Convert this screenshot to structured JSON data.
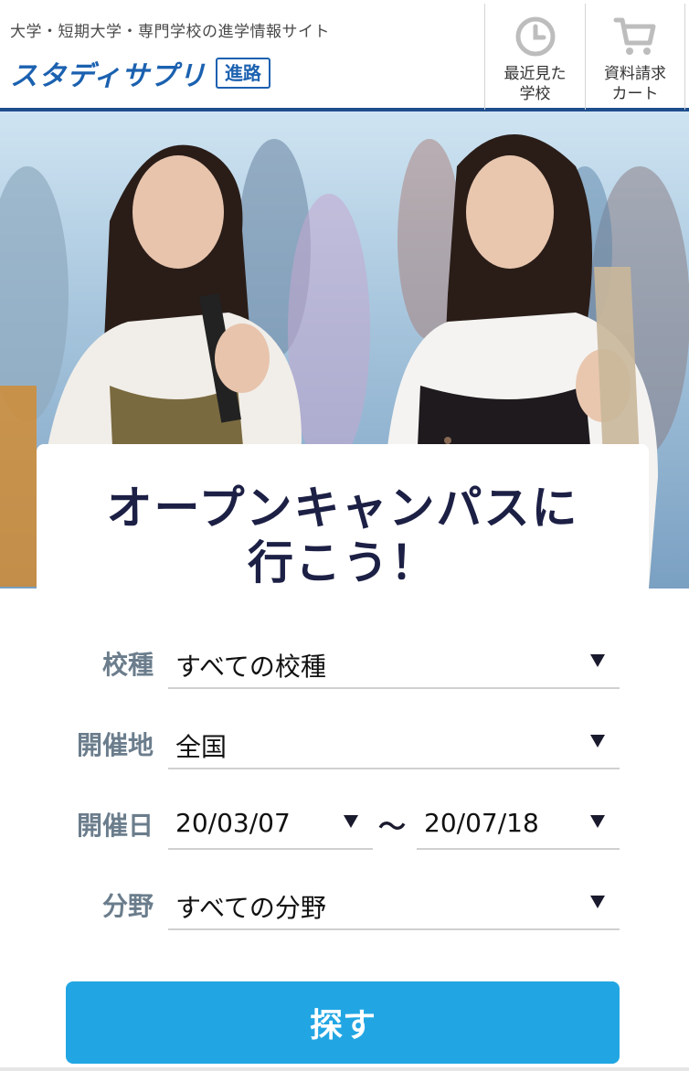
{
  "header": {
    "tagline": "大学・短期大学・専門学校の進学情報サイト",
    "logo_main": "スタディサプリ",
    "logo_sub": "進路",
    "recent_label": "最近見た\n学校",
    "cart_label": "資料請求\nカート",
    "recent_icon": "clock-icon",
    "cart_icon": "cart-icon"
  },
  "card": {
    "title": "オープンキャンパスに\n行こう！",
    "school_type": {
      "label": "校種",
      "value": "すべての校種"
    },
    "location": {
      "label": "開催地",
      "value": "全国"
    },
    "date": {
      "label": "開催日",
      "from": "20/03/07",
      "separator": "〜",
      "to": "20/07/18"
    },
    "field": {
      "label": "分野",
      "value": "すべての分野"
    },
    "search_label": "探す"
  },
  "colors": {
    "brand": "#1b61b0",
    "header_rule": "#1f4e8c",
    "title": "#1d2045",
    "label": "#6b7d8c",
    "button": "#22a6e3"
  }
}
